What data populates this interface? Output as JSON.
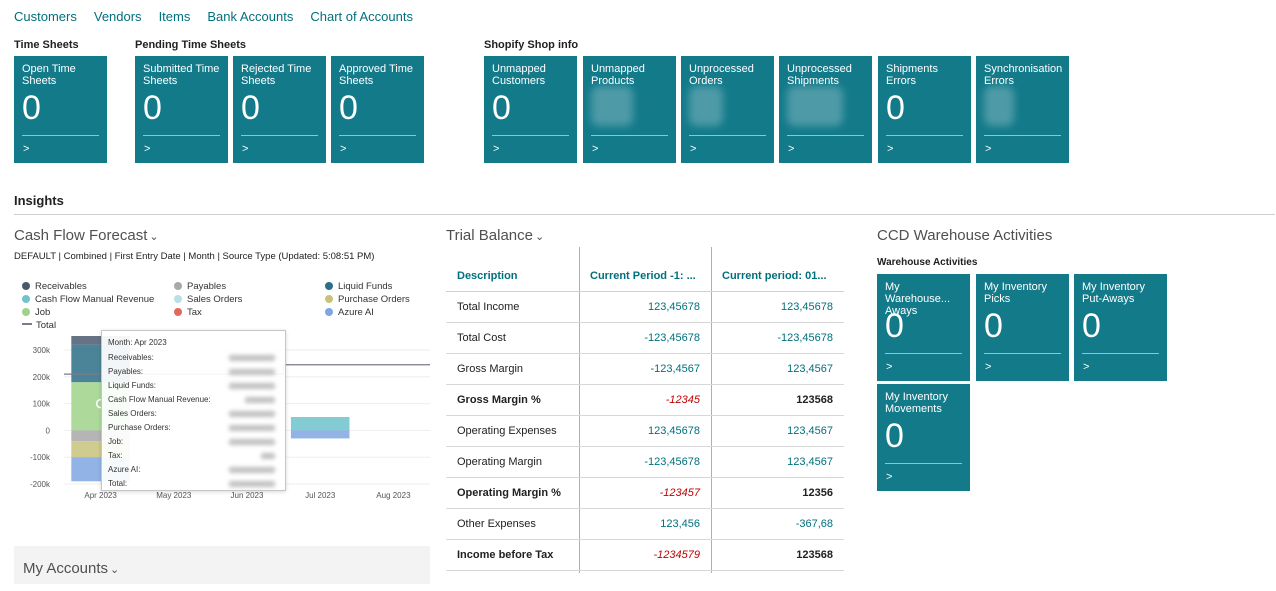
{
  "nav": [
    "Customers",
    "Vendors",
    "Items",
    "Bank Accounts",
    "Chart of Accounts"
  ],
  "groups": {
    "time_sheets": "Time Sheets",
    "pending": "Pending Time Sheets",
    "shopify": "Shopify Shop info"
  },
  "tiles": {
    "open_time_sheets": {
      "label": "Open Time Sheets",
      "value": "0"
    },
    "submitted_time_sheets": {
      "label": "Submitted Time Sheets",
      "value": "0"
    },
    "rejected_time_sheets": {
      "label": "Rejected Time Sheets",
      "value": "0"
    },
    "approved_time_sheets": {
      "label": "Approved Time Sheets",
      "value": "0"
    },
    "unmapped_customers": {
      "label": "Unmapped Customers",
      "value": "0"
    },
    "unmapped_products": {
      "label": "Unmapped Products"
    },
    "unprocessed_orders": {
      "label": "Unprocessed Orders"
    },
    "unprocessed_shipments": {
      "label": "Unprocessed Shipments"
    },
    "shipments_errors": {
      "label": "Shipments Errors",
      "value": "0"
    },
    "synchronisation_errors": {
      "label": "Synchronisation Errors"
    },
    "arrow": ">"
  },
  "insights": "Insights",
  "cash_flow": {
    "title": "Cash Flow Forecast",
    "subtitle": "DEFAULT | Combined | First Entry Date | Month | Source Type (Updated:  5:08:51 PM)",
    "legend": [
      {
        "name": "Receivables",
        "color": "#4a5a6e",
        "shape": "dot"
      },
      {
        "name": "Payables",
        "color": "#a8a8a8",
        "shape": "dot"
      },
      {
        "name": "Liquid Funds",
        "color": "#2c6e86",
        "shape": "dot"
      },
      {
        "name": "Cash Flow Manual Revenue",
        "color": "#6ec3cc",
        "shape": "dot"
      },
      {
        "name": "Sales Orders",
        "color": "#b9dfe8",
        "shape": "dot"
      },
      {
        "name": "Purchase Orders",
        "color": "#c8c27a",
        "shape": "dot"
      },
      {
        "name": "Job",
        "color": "#9fd38a",
        "shape": "dot"
      },
      {
        "name": "Tax",
        "color": "#e06a5a",
        "shape": "dot"
      },
      {
        "name": "Azure AI",
        "color": "#7ea6e0",
        "shape": "dot"
      },
      {
        "name": "Total",
        "color": "#7a7a8a",
        "shape": "line"
      }
    ],
    "tooltip": {
      "header": "Month: Apr 2023",
      "rows": [
        "Receivables:",
        "Payables:",
        "Liquid Funds:",
        "Cash Flow Manual Revenue:",
        "Sales Orders:",
        "Purchase Orders:",
        "Job:",
        "Tax:",
        "Azure AI:",
        "Total:"
      ]
    }
  },
  "chart_data": {
    "type": "bar",
    "categories": [
      "Apr 2023",
      "May 2023",
      "Jun 2023",
      "Jul 2023",
      "Aug 2023"
    ],
    "ylim": [
      -200000,
      300000
    ],
    "yticks": [
      {
        "value": 300000,
        "label": "300k"
      },
      {
        "value": 200000,
        "label": "200k"
      },
      {
        "value": 100000,
        "label": "100k"
      },
      {
        "value": 0,
        "label": "0"
      },
      {
        "value": -100000,
        "label": "-100k"
      },
      {
        "value": -200000,
        "label": "-200k"
      }
    ],
    "series": [
      {
        "name": "Job",
        "color": "#9fd38a",
        "values": [
          180000,
          0,
          0,
          0,
          0
        ]
      },
      {
        "name": "Liquid Funds",
        "color": "#2c6e86",
        "values": [
          140000,
          0,
          0,
          0,
          0
        ]
      },
      {
        "name": "Receivables",
        "color": "#4a5a6e",
        "values": [
          45000,
          0,
          0,
          0,
          0
        ]
      },
      {
        "name": "Cash Flow Manual Revenue",
        "color": "#6ec3cc",
        "values": [
          0,
          0,
          0,
          50000,
          0
        ]
      },
      {
        "name": "Sales Orders",
        "color": "#b9dfe8",
        "values": [
          0,
          0,
          0,
          0,
          0
        ]
      },
      {
        "name": "Payables",
        "color": "#a8a8a8",
        "values": [
          -40000,
          0,
          0,
          0,
          0
        ]
      },
      {
        "name": "Purchase Orders",
        "color": "#c8c27a",
        "values": [
          -60000,
          0,
          0,
          0,
          0
        ]
      },
      {
        "name": "Azure AI",
        "color": "#7ea6e0",
        "values": [
          -90000,
          0,
          0,
          -30000,
          0
        ]
      }
    ],
    "total": {
      "name": "Total",
      "color": "#7a7a8a",
      "values": [
        210000,
        210000,
        210000,
        245000,
        245000
      ]
    }
  },
  "my_accounts": "My Accounts",
  "trial_balance": {
    "title": "Trial Balance",
    "columns": [
      "Description",
      "Current Period -1: ...",
      "Current period: 01..."
    ],
    "rows": [
      {
        "desc": "Total Income",
        "prev": "123,45678",
        "cur": "123,45678",
        "style": "normal"
      },
      {
        "desc": "Total Cost",
        "prev": "-123,45678",
        "cur": "-123,45678",
        "style": "normal"
      },
      {
        "desc": "Gross Margin",
        "prev": "-123,4567",
        "cur": "123,4567",
        "style": "normal"
      },
      {
        "desc": "Gross Margin %",
        "prev": "-12345",
        "cur": "123568",
        "style": "bold"
      },
      {
        "desc": "Operating Expenses",
        "prev": "123,45678",
        "cur": "123,4567",
        "style": "normal"
      },
      {
        "desc": "Operating Margin",
        "prev": "-123,45678",
        "cur": "123,4567",
        "style": "normal"
      },
      {
        "desc": "Operating Margin %",
        "prev": "-123457",
        "cur": "12356",
        "style": "bold"
      },
      {
        "desc": "Other Expenses",
        "prev": "123,456",
        "cur": "-367,68",
        "style": "normal"
      },
      {
        "desc": "Income before Tax",
        "prev": "-1234579",
        "cur": "123568",
        "style": "bold"
      }
    ]
  },
  "warehouse": {
    "title": "CCD Warehouse Activities",
    "subtitle": "Warehouse Activities",
    "tiles": [
      {
        "label": "My Warehouse... Aways",
        "value": "0"
      },
      {
        "label": "My Inventory Picks",
        "value": "0"
      },
      {
        "label": "My Inventory Put-Aways",
        "value": "0"
      },
      {
        "label": "My Inventory Movements",
        "value": "0"
      }
    ]
  }
}
